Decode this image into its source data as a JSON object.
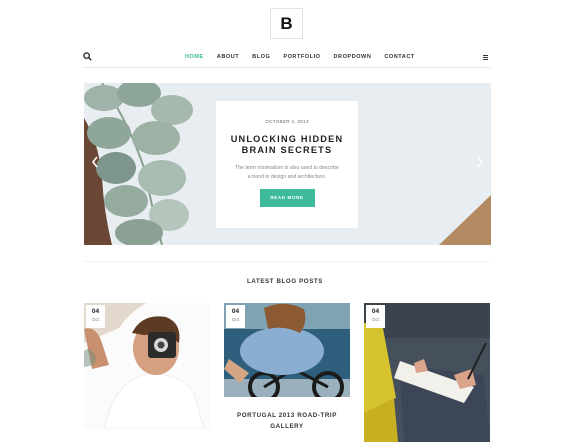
{
  "logo": {
    "text": "B"
  },
  "nav": {
    "items": [
      {
        "label": "HOME",
        "active": true
      },
      {
        "label": "ABOUT",
        "active": false
      },
      {
        "label": "BLOG",
        "active": false
      },
      {
        "label": "PORTFOLIO",
        "active": false
      },
      {
        "label": "DROPDOWN",
        "active": false
      },
      {
        "label": "CONTACT",
        "active": false
      }
    ]
  },
  "hero": {
    "date": "OCTOBER 4, 2013",
    "title_line1": "UNLOCKING HIDDEN",
    "title_line2": "BRAIN SECRETS",
    "text_line1": "The term minimalism is also used to describe",
    "text_line2": "a trend in design and architecture.",
    "button_label": "READ MORE"
  },
  "section": {
    "title": "LATEST BLOG POSTS"
  },
  "posts": [
    {
      "day": "04",
      "month": "Oct",
      "title": ""
    },
    {
      "day": "04",
      "month": "Oct",
      "title_line1": "PORTUGAL 2013 ROAD-TRIP",
      "title_line2": "GALLERY"
    },
    {
      "day": "04",
      "month": "Oct",
      "title": ""
    }
  ],
  "colors": {
    "accent": "#3dbb9b",
    "text": "#222222",
    "muted": "#888888"
  },
  "icons": {
    "search": "search-icon",
    "menu": "hamburger-icon",
    "prev": "chevron-left-icon",
    "next": "chevron-right-icon"
  }
}
